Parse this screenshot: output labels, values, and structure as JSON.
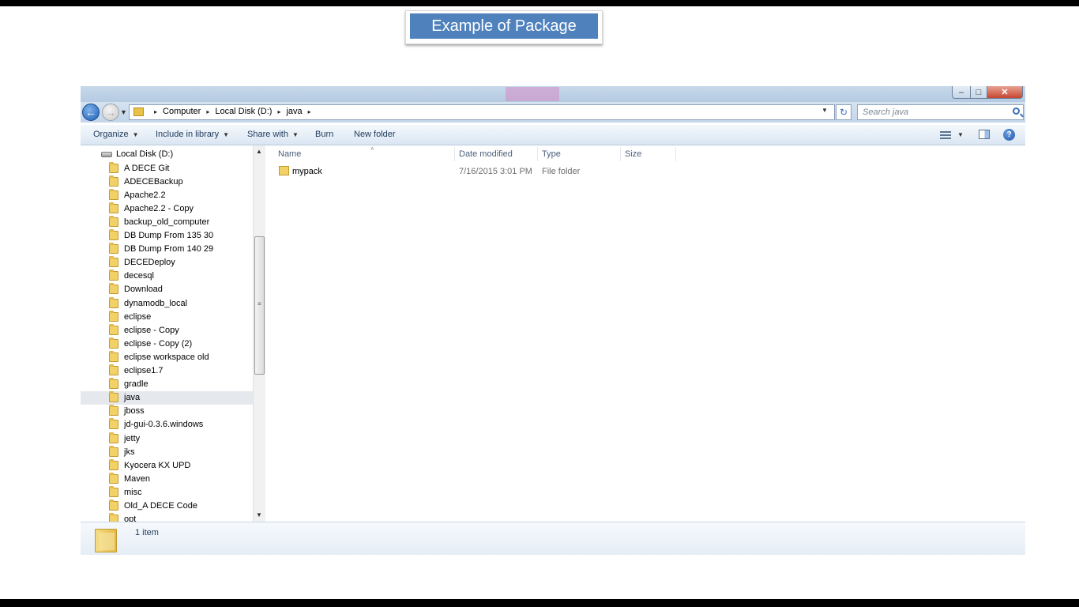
{
  "slide": {
    "title": "Example of Package"
  },
  "window": {
    "controls": {
      "minimize": "–",
      "maximize": "□",
      "close": "✕"
    },
    "navigation": {
      "back_icon": "back-arrow-icon",
      "forward_icon": "forward-arrow-icon",
      "back_glyph": "←",
      "forward_glyph": "→",
      "recent_glyph": "▼"
    },
    "address": {
      "crumbs": [
        "Computer",
        "Local Disk (D:)",
        "java"
      ],
      "separator": "▸",
      "dropdown_glyph": "▼",
      "refresh_glyph": "↻"
    },
    "search": {
      "placeholder": "Search java"
    },
    "toolbar": {
      "organize": "Organize",
      "include_in_library": "Include in library",
      "share_with": "Share with",
      "burn": "Burn",
      "new_folder": "New folder",
      "caret": "▼",
      "help": "?"
    },
    "nav_pane": {
      "root": "Local Disk (D:)",
      "selected": "java",
      "folders": [
        "A DECE Git",
        "ADECEBackup",
        "Apache2.2",
        "Apache2.2 - Copy",
        "backup_old_computer",
        "DB Dump From 135 30",
        "DB Dump From 140 29",
        "DECEDeploy",
        "decesql",
        "Download",
        "dynamodb_local",
        "eclipse",
        "eclipse - Copy",
        "eclipse - Copy (2)",
        "eclipse workspace old",
        "eclipse1.7",
        "gradle",
        "java",
        "jboss",
        "jd-gui-0.3.6.windows",
        "jetty",
        "jks",
        "Kyocera KX UPD",
        "Maven",
        "misc",
        "Old_A DECE Code",
        "opt"
      ]
    },
    "scrollbar": {
      "up": "▲",
      "down": "▼",
      "grip": "≡"
    },
    "columns": {
      "name": "Name",
      "date_modified": "Date modified",
      "type": "Type",
      "size": "Size",
      "sort_glyph": "˄"
    },
    "files": [
      {
        "name": "mypack",
        "date_modified": "7/16/2015 3:01 PM",
        "type": "File folder",
        "size": ""
      }
    ],
    "status": {
      "item_count": "1 item"
    }
  },
  "colors": {
    "slide_title_bg": "#4f81bd",
    "selected_row": "#e5e9ee",
    "folder": "#f2d267"
  }
}
